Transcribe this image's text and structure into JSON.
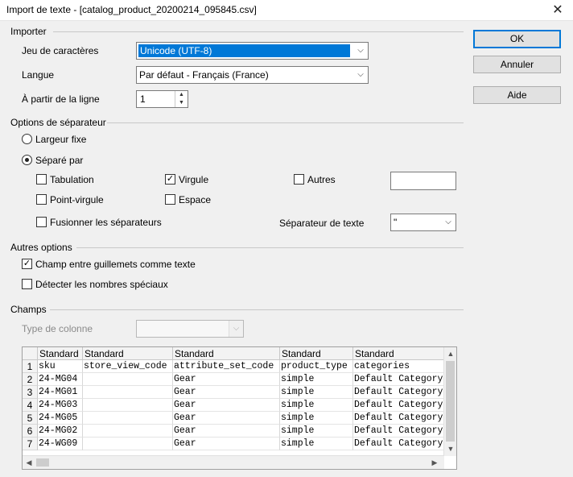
{
  "window": {
    "title": "Import de texte - [catalog_product_20200214_095845.csv]"
  },
  "buttons": {
    "ok": "OK",
    "cancel": "Annuler",
    "help": "Aide"
  },
  "import": {
    "section": "Importer",
    "charset_label": "Jeu de caractères",
    "charset_value": "Unicode (UTF-8)",
    "language_label": "Langue",
    "language_value": "Par défaut - Français (France)",
    "from_row_label": "À partir de la ligne",
    "from_row_value": "1"
  },
  "separator": {
    "section": "Options de séparateur",
    "fixed_width": "Largeur fixe",
    "separated_by": "Séparé par",
    "tab": "Tabulation",
    "comma": "Virgule",
    "other": "Autres",
    "semicolon": "Point-virgule",
    "space": "Espace",
    "merge": "Fusionner les séparateurs",
    "text_delim_label": "Séparateur de texte",
    "text_delim_value": "\"",
    "checked": {
      "tab": false,
      "comma": true,
      "other": false,
      "semicolon": false,
      "space": false,
      "merge": false
    }
  },
  "other_options": {
    "section": "Autres options",
    "quoted_as_text": "Champ entre guillemets comme texte",
    "detect_special": "Détecter les nombres spéciaux",
    "checked": {
      "quoted_as_text": true,
      "detect_special": false
    }
  },
  "fields": {
    "section": "Champs",
    "column_type_label": "Type de colonne",
    "column_type_value": ""
  },
  "preview": {
    "headers": [
      "Standard",
      "Standard",
      "Standard",
      "Standard",
      "Standard"
    ],
    "rows": [
      [
        "1",
        "sku",
        "store_view_code",
        "attribute_set_code",
        "product_type",
        "categories"
      ],
      [
        "2",
        "24-MG04",
        "",
        "Gear",
        "simple",
        "Default Category"
      ],
      [
        "3",
        "24-MG01",
        "",
        "Gear",
        "simple",
        "Default Category"
      ],
      [
        "4",
        "24-MG03",
        "",
        "Gear",
        "simple",
        "Default Category"
      ],
      [
        "5",
        "24-MG05",
        "",
        "Gear",
        "simple",
        "Default Category"
      ],
      [
        "6",
        "24-MG02",
        "",
        "Gear",
        "simple",
        "Default Category"
      ],
      [
        "7",
        "24-WG09",
        "",
        "Gear",
        "simple",
        "Default Category"
      ]
    ]
  }
}
